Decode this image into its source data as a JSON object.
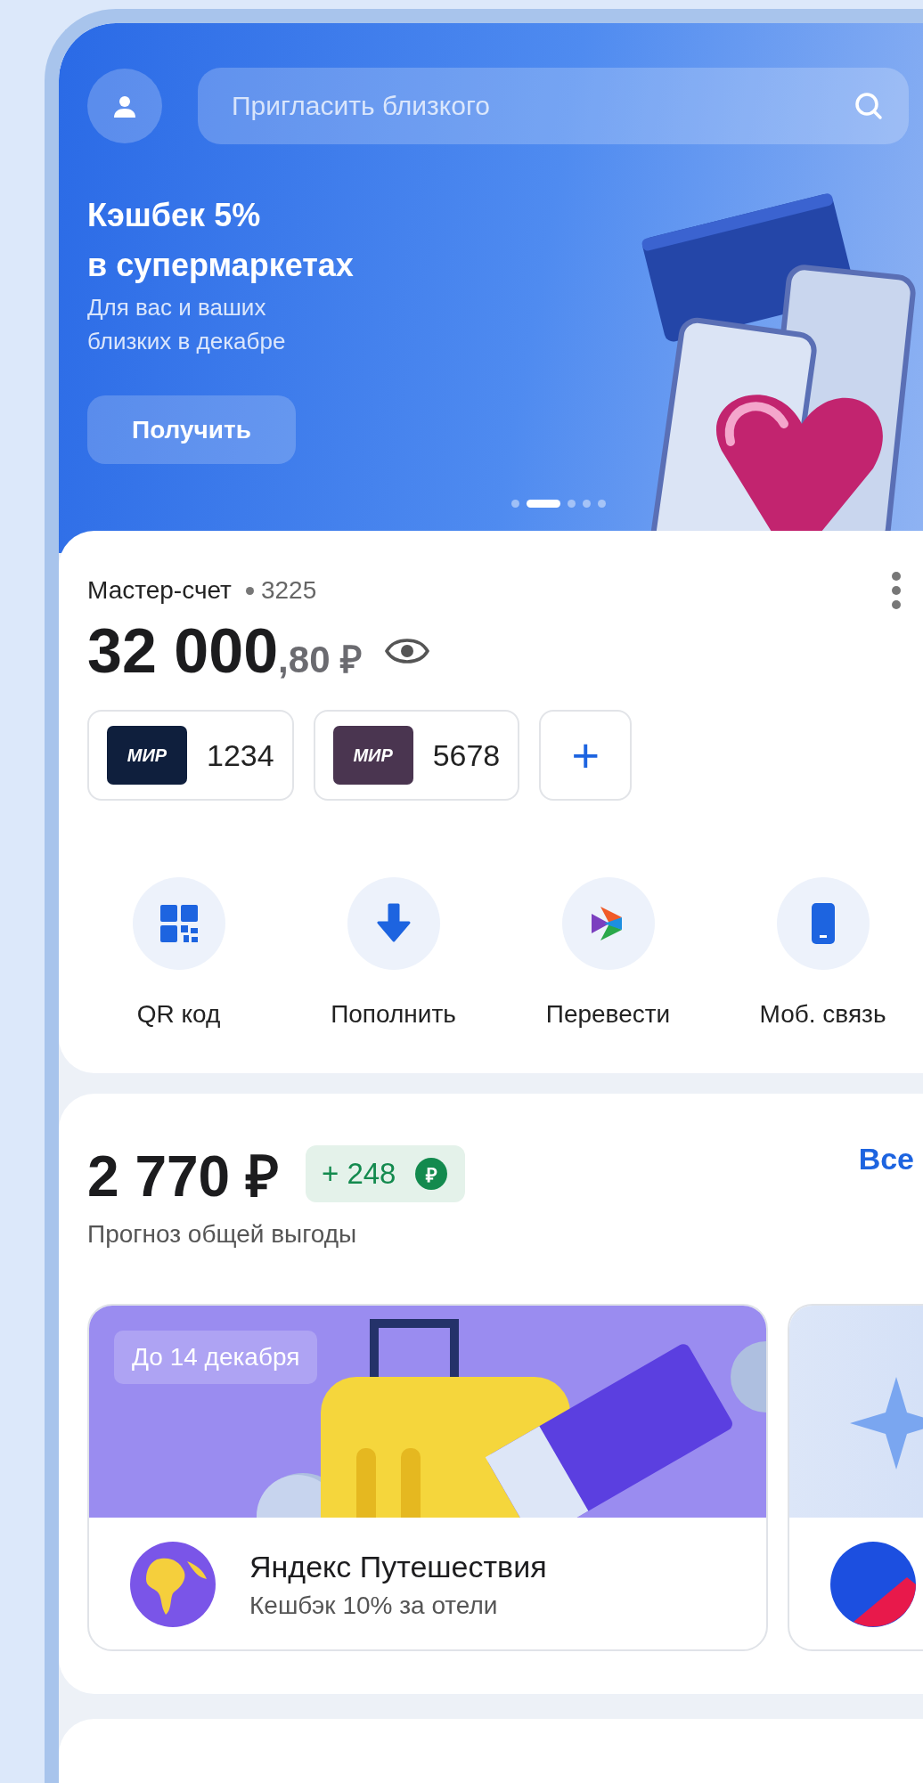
{
  "header": {
    "search": {
      "placeholder": "Пригласить близкого"
    }
  },
  "banner": {
    "title_lines": [
      "Кэшбек 5%",
      "в супермаркетах"
    ],
    "subtitle": "Для вас и ваших близких в декабре",
    "button": "Получить",
    "pager": [
      {
        "selected": false
      },
      {
        "selected": true
      },
      {
        "selected": false
      },
      {
        "selected": false
      },
      {
        "selected": false
      }
    ]
  },
  "account": {
    "name": "Мастер-счет",
    "number": "3225",
    "balance_main": "32 000",
    "balance_fraction": ",80 ₽",
    "cards": [
      {
        "brand": "МИР",
        "number": "1234",
        "color": "#0f1f3d"
      },
      {
        "brand": "МИР",
        "number": "5678",
        "color": "#4a3550"
      }
    ],
    "add_card": "+",
    "actions": [
      {
        "kind": "qr",
        "label": "QR код"
      },
      {
        "kind": "deposit",
        "label": "Пополнить"
      },
      {
        "kind": "transfer",
        "label": "Перевести"
      },
      {
        "kind": "phone",
        "label": "Моб. связь"
      }
    ]
  },
  "benefits": {
    "amount": "2 770 ₽",
    "bonus": "+ 248",
    "bonus_icon": "₽",
    "link": "Все",
    "caption": "Прогноз общей выгоды",
    "promos": [
      {
        "kind": "travel",
        "deadline": "До 14 декабря",
        "title": "Яндекс Путешествия",
        "subtitle": "Кешбэк 10% за отели"
      },
      {
        "kind": "marketplace"
      }
    ]
  }
}
